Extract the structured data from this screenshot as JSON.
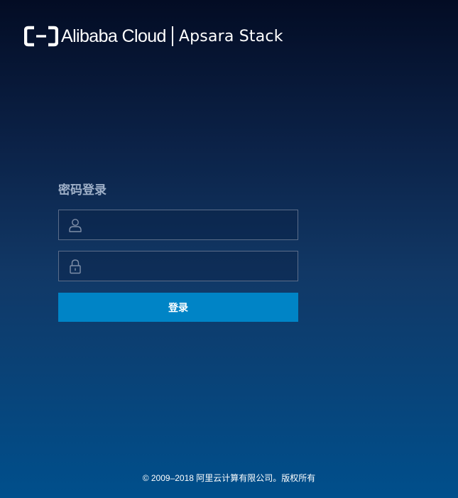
{
  "header": {
    "brand": "Alibaba Cloud",
    "product": "Apsara Stack"
  },
  "login": {
    "title": "密码登录",
    "username": {
      "value": "",
      "placeholder": ""
    },
    "password": {
      "value": "",
      "placeholder": ""
    },
    "submit_label": "登录"
  },
  "footer": {
    "copyright": "© 2009–2018 阿里云计算有限公司。版权所有"
  },
  "icons": {
    "logo": "alibaba-cloud-logo-icon",
    "username": "user-icon",
    "password": "lock-icon"
  },
  "colors": {
    "background_top": "#030c24",
    "background_bottom": "#004f8c",
    "button": "#0084c6",
    "title": "#9fb0c8",
    "field_border": "#5b6d8a"
  }
}
